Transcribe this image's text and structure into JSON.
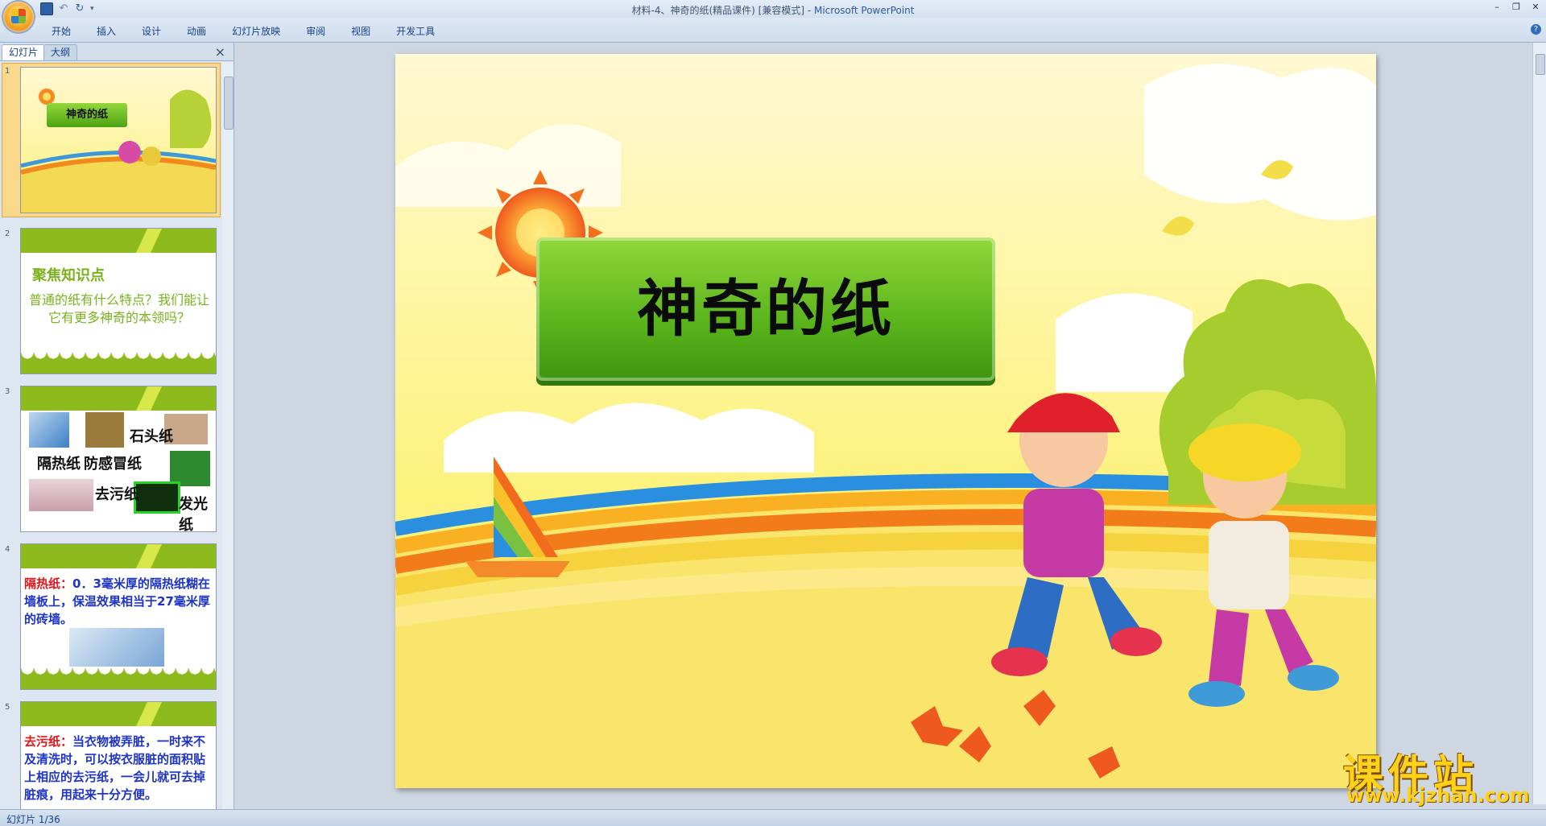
{
  "window": {
    "title": "材料-4、神奇的纸(精品课件) [兼容模式] - ",
    "app_name": "Microsoft PowerPoint"
  },
  "ribbon": {
    "tabs": [
      "开始",
      "插入",
      "设计",
      "动画",
      "幻灯片放映",
      "审阅",
      "视图",
      "开发工具"
    ]
  },
  "panel": {
    "tab_slides": "幻灯片",
    "tab_outline": "大纲",
    "close": "×"
  },
  "thumbnails": {
    "slide1": {
      "num": "1",
      "title": "神奇的纸"
    },
    "slide2": {
      "num": "2",
      "title": "聚焦知识点",
      "body": "普通的纸有什么特点？我们能让它有更多神奇的本领吗？"
    },
    "slide3": {
      "num": "3",
      "labels": [
        "石头纸",
        "隔热纸",
        "防感冒纸",
        "去污纸",
        "发光纸"
      ]
    },
    "slide4": {
      "num": "4",
      "lead": "隔热纸：",
      "body": "0．3毫米厚的隔热纸糊在墙板上，保温效果相当于27毫米厚的砖墙。"
    },
    "slide5": {
      "num": "5",
      "lead": "去污纸：",
      "body": "当衣物被弄脏，一时来不及清洗时，可以按衣服脏的面积贴上相应的去污纸，一会儿就可去掉脏痕，用起来十分方便。"
    }
  },
  "slide": {
    "title": "神奇的纸"
  },
  "watermark": {
    "main": "课件站",
    "sub": "www.kjzhan.com"
  },
  "status": {
    "text": "幻灯片 1/36"
  },
  "colors": {
    "accent_green": "#8dbb1e",
    "title_green": "#59b41b",
    "selection": "#fbd98c"
  }
}
